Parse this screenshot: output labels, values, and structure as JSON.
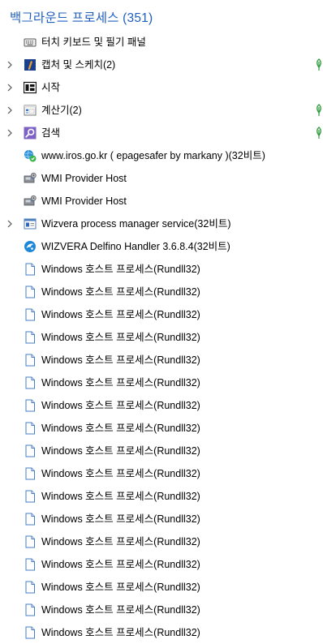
{
  "group": {
    "title": "백그라운드 프로세스 (351)"
  },
  "colors": {
    "group_title": "#1f5fbf",
    "efficiency_leaf": "#2e9a3c"
  },
  "processes": [
    {
      "name": "터치 키보드 및 필기 패널",
      "icon": "keyboard-icon",
      "expandable": false,
      "efficiency_mode": false
    },
    {
      "name": "캡처 및 스케치(2)",
      "icon": "snip-sketch-icon",
      "expandable": true,
      "efficiency_mode": true
    },
    {
      "name": "시작",
      "icon": "start-icon",
      "expandable": true,
      "efficiency_mode": false
    },
    {
      "name": "계산기(2)",
      "icon": "calculator-icon",
      "expandable": true,
      "efficiency_mode": true
    },
    {
      "name": "검색",
      "icon": "search-icon",
      "expandable": true,
      "efficiency_mode": true
    },
    {
      "name": "www.iros.go.kr ( epagesafer by markany )(32비트)",
      "icon": "globe-shield-icon",
      "expandable": false,
      "efficiency_mode": false
    },
    {
      "name": "WMI Provider Host",
      "icon": "wmi-icon",
      "expandable": false,
      "efficiency_mode": false
    },
    {
      "name": "WMI Provider Host",
      "icon": "wmi-icon",
      "expandable": false,
      "efficiency_mode": false
    },
    {
      "name": "Wizvera process manager service(32비트)",
      "icon": "service-window-icon",
      "expandable": true,
      "efficiency_mode": false
    },
    {
      "name": "WIZVERA Delfino Handler 3.6.8.4(32비트)",
      "icon": "delfino-icon",
      "expandable": false,
      "efficiency_mode": false
    },
    {
      "name": "Windows 호스트 프로세스(Rundll32)",
      "icon": "document-icon",
      "expandable": false,
      "efficiency_mode": false
    },
    {
      "name": "Windows 호스트 프로세스(Rundll32)",
      "icon": "document-icon",
      "expandable": false,
      "efficiency_mode": false
    },
    {
      "name": "Windows 호스트 프로세스(Rundll32)",
      "icon": "document-icon",
      "expandable": false,
      "efficiency_mode": false
    },
    {
      "name": "Windows 호스트 프로세스(Rundll32)",
      "icon": "document-icon",
      "expandable": false,
      "efficiency_mode": false
    },
    {
      "name": "Windows 호스트 프로세스(Rundll32)",
      "icon": "document-icon",
      "expandable": false,
      "efficiency_mode": false
    },
    {
      "name": "Windows 호스트 프로세스(Rundll32)",
      "icon": "document-icon",
      "expandable": false,
      "efficiency_mode": false
    },
    {
      "name": "Windows 호스트 프로세스(Rundll32)",
      "icon": "document-icon",
      "expandable": false,
      "efficiency_mode": false
    },
    {
      "name": "Windows 호스트 프로세스(Rundll32)",
      "icon": "document-icon",
      "expandable": false,
      "efficiency_mode": false
    },
    {
      "name": "Windows 호스트 프로세스(Rundll32)",
      "icon": "document-icon",
      "expandable": false,
      "efficiency_mode": false
    },
    {
      "name": "Windows 호스트 프로세스(Rundll32)",
      "icon": "document-icon",
      "expandable": false,
      "efficiency_mode": false
    },
    {
      "name": "Windows 호스트 프로세스(Rundll32)",
      "icon": "document-icon",
      "expandable": false,
      "efficiency_mode": false
    },
    {
      "name": "Windows 호스트 프로세스(Rundll32)",
      "icon": "document-icon",
      "expandable": false,
      "efficiency_mode": false
    },
    {
      "name": "Windows 호스트 프로세스(Rundll32)",
      "icon": "document-icon",
      "expandable": false,
      "efficiency_mode": false
    },
    {
      "name": "Windows 호스트 프로세스(Rundll32)",
      "icon": "document-icon",
      "expandable": false,
      "efficiency_mode": false
    },
    {
      "name": "Windows 호스트 프로세스(Rundll32)",
      "icon": "document-icon",
      "expandable": false,
      "efficiency_mode": false
    },
    {
      "name": "Windows 호스트 프로세스(Rundll32)",
      "icon": "document-icon",
      "expandable": false,
      "efficiency_mode": false
    },
    {
      "name": "Windows 호스트 프로세스(Rundll32)",
      "icon": "document-icon",
      "expandable": false,
      "efficiency_mode": false
    }
  ]
}
